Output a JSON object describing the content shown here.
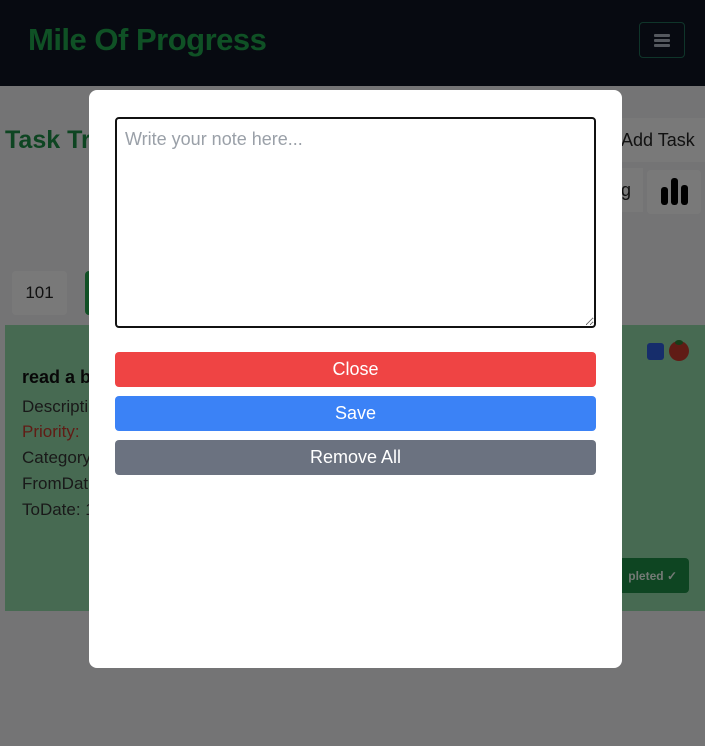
{
  "header": {
    "brand": "Mile Of Progress",
    "menu_icon": "hamburger-menu-icon"
  },
  "page": {
    "title_partial": "Task Tr",
    "add_task_label": "Add Task",
    "sort_label_partial": "g",
    "stats_icon": "bar-chart-icon",
    "task_count": "101"
  },
  "task": {
    "name_partial": "read a b",
    "description_partial": "Descripti",
    "priority_partial": "Priority: ",
    "category_partial": "Category",
    "from_date_partial": "FromDat",
    "to_date_partial": "ToDate: 1",
    "completed_partial": "pleted ✓",
    "note_icon": "sticky-note-icon",
    "tomato_icon": "tomato-icon"
  },
  "modal": {
    "note_placeholder": "Write your note here...",
    "note_value": "",
    "close_label": "Close",
    "save_label": "Save",
    "remove_all_label": "Remove All"
  },
  "colors": {
    "header_bg": "#0f1522",
    "brand": "#1fa34a",
    "close": "#ef4444",
    "save": "#3b82f6",
    "remove_all": "#6b7280",
    "task_card": "#8fd4a4"
  }
}
